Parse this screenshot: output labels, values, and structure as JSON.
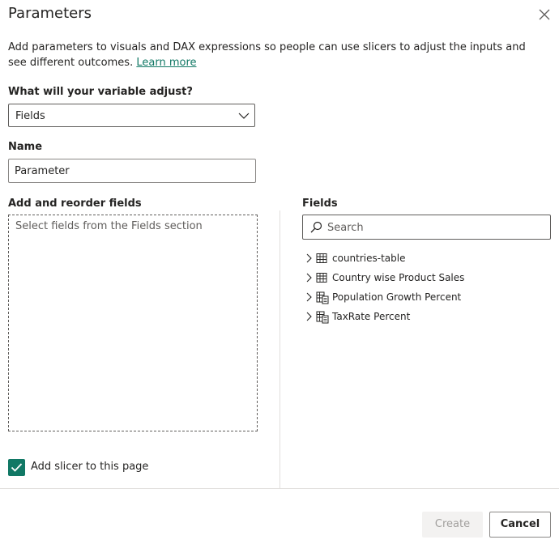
{
  "dialog": {
    "title": "Parameters",
    "description": "Add parameters to visuals and DAX expressions so people can use slicers to adjust the inputs and see different outcomes.",
    "learn_more": "Learn more"
  },
  "variable": {
    "label": "What will your variable adjust?",
    "selected": "Fields"
  },
  "name": {
    "label": "Name",
    "value": "Parameter"
  },
  "reorder": {
    "label": "Add and reorder fields",
    "hint": "Select fields from the Fields section"
  },
  "fields_pane": {
    "label": "Fields",
    "search_placeholder": "Search",
    "items": [
      {
        "label": "countries-table",
        "icon": "table-icon"
      },
      {
        "label": "Country wise Product Sales",
        "icon": "table-icon"
      },
      {
        "label": "Population Growth Percent",
        "icon": "calculated-table-icon"
      },
      {
        "label": "TaxRate Percent",
        "icon": "calculated-table-icon"
      }
    ]
  },
  "slicer": {
    "label": "Add slicer to this page",
    "checked": true
  },
  "buttons": {
    "create": "Create",
    "cancel": "Cancel"
  },
  "colors": {
    "accent": "#117865",
    "disabled_text": "#a19f9d"
  }
}
